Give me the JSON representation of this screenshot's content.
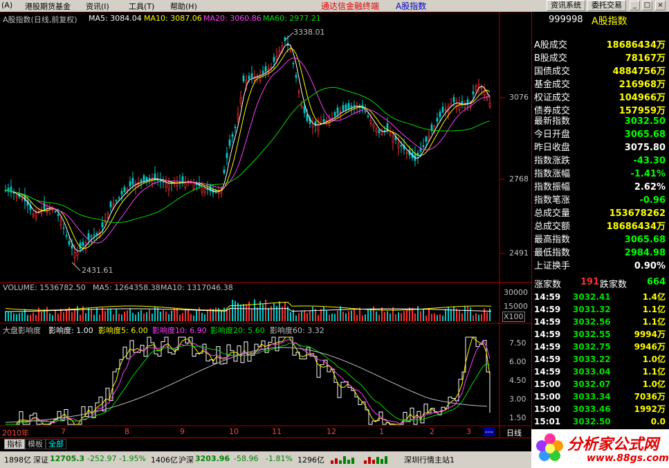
{
  "menubar": {
    "items": [
      "(A)",
      "港股期货基金",
      "资讯(I)",
      "工具(T)",
      "帮助(H)"
    ],
    "app_title": "通达信金融终端",
    "doc_title": "A股指数",
    "btn_info": "资讯系统",
    "btn_trade": "委托交易",
    "win_min": "_",
    "win_max": "□",
    "win_close": "×"
  },
  "chart": {
    "header_name": "A股指数(日线,前复权)",
    "ma5": "MA5: 3084.04",
    "ma10": "MA10: 3087.06",
    "ma20": "MA20: 3060.86",
    "ma60": "MA60: 2977.21",
    "high_marker": "3338.01",
    "low_marker": "2431.61",
    "price_ticks": [
      "3076",
      "2768",
      "2491"
    ],
    "volume_header": "VOLUME: 1536782.50",
    "vol_ma5": "MA5: 1264358.38",
    "vol_ma10": "MA10: 1317046.38",
    "vol_ticks": [
      "30000",
      "15000",
      "X100"
    ],
    "ind_header": "大盘影响度",
    "ind_1": "影响度: 1.00",
    "ind_5": "影响度5: 6.00",
    "ind_10": "影响度10: 6.90",
    "ind_20": "影响度20: 5.60",
    "ind_60": "影响度60: 3.32",
    "ind_ticks": [
      "7.50",
      "6.00",
      "4.50",
      "3.00",
      "1.50"
    ],
    "months": [
      "2010年",
      "7",
      "8",
      "9",
      "10",
      "11",
      "12",
      "1",
      "2",
      "3"
    ],
    "period": "日线",
    "more": "---"
  },
  "panel": {
    "code": "999998",
    "name": "A股指数",
    "stats": [
      {
        "k": "A股成交",
        "v": "18686434万",
        "c": "#ffff00"
      },
      {
        "k": "B股成交",
        "v": "78167万",
        "c": "#ffff00"
      },
      {
        "k": "国债成交",
        "v": "4884756万",
        "c": "#ffff00"
      },
      {
        "k": "基金成交",
        "v": "216968万",
        "c": "#ffff00"
      },
      {
        "k": "权证成交",
        "v": "104966万",
        "c": "#ffff00"
      },
      {
        "k": "债券成交",
        "v": "157959万",
        "c": "#ffff00"
      }
    ],
    "quotes": [
      {
        "k": "最新指数",
        "v": "3032.50",
        "c": "#00ff00"
      },
      {
        "k": "今日开盘",
        "v": "3065.68",
        "c": "#00ff00"
      },
      {
        "k": "昨日收盘",
        "v": "3075.80",
        "c": "#ffffff"
      },
      {
        "k": "指数涨跌",
        "v": "-43.30",
        "c": "#00ff00"
      },
      {
        "k": "指数涨幅",
        "v": "-1.41%",
        "c": "#00ff00"
      },
      {
        "k": "指数振幅",
        "v": "2.62%",
        "c": "#ffffff"
      },
      {
        "k": "指数笔涨",
        "v": "-0.96",
        "c": "#00ff00"
      },
      {
        "k": "总成交量",
        "v": "153678262",
        "c": "#ffff00"
      },
      {
        "k": "总成交额",
        "v": "18686434万",
        "c": "#ffff00"
      },
      {
        "k": "最高指数",
        "v": "3065.68",
        "c": "#00ff00"
      },
      {
        "k": "最低指数",
        "v": "2984.98",
        "c": "#00ff00"
      },
      {
        "k": "上证换手",
        "v": "0.90%",
        "c": "#ffffff"
      }
    ],
    "rise_label": "涨家数",
    "rise_count": "191",
    "fall_label": "跌家数",
    "fall_count": "664",
    "ticks": [
      {
        "t": "14:59",
        "p": "3032.41",
        "q": "1.4亿"
      },
      {
        "t": "14:59",
        "p": "3031.32",
        "q": "1.1亿"
      },
      {
        "t": "14:59",
        "p": "3032.56",
        "q": "1.1亿"
      },
      {
        "t": "14:59",
        "p": "3032.55",
        "q": "9994万"
      },
      {
        "t": "14:59",
        "p": "3032.75",
        "q": "9946万"
      },
      {
        "t": "14:59",
        "p": "3033.22",
        "q": "1.0亿"
      },
      {
        "t": "14:59",
        "p": "3033.04",
        "q": "1.1亿"
      },
      {
        "t": "15:00",
        "p": "3032.07",
        "q": "1.0亿"
      },
      {
        "t": "15:00",
        "p": "3033.34",
        "q": "7036万"
      },
      {
        "t": "15:00",
        "p": "3033.46",
        "q": "1992万"
      },
      {
        "t": "15:01",
        "p": "3032.50",
        "q": "0.0"
      }
    ]
  },
  "tabs": [
    "指标",
    "模板",
    "全部"
  ],
  "status": {
    "s1": "1898亿",
    "sz_label": "深证",
    "sz_val": "12705.3",
    "sz_chg": "-252.97",
    "sz_pct": "-1.95%",
    "sz_amt": "1406亿",
    "hs_label": "沪深",
    "hs_val": "3203.96",
    "hs_chg": "-58.96",
    "hs_pct": "-1.81%",
    "hs_amt": "1296亿",
    "server": "深圳行情主站1"
  },
  "logo": {
    "text": "分析家公式网",
    "url": "www.88gs.com"
  }
}
